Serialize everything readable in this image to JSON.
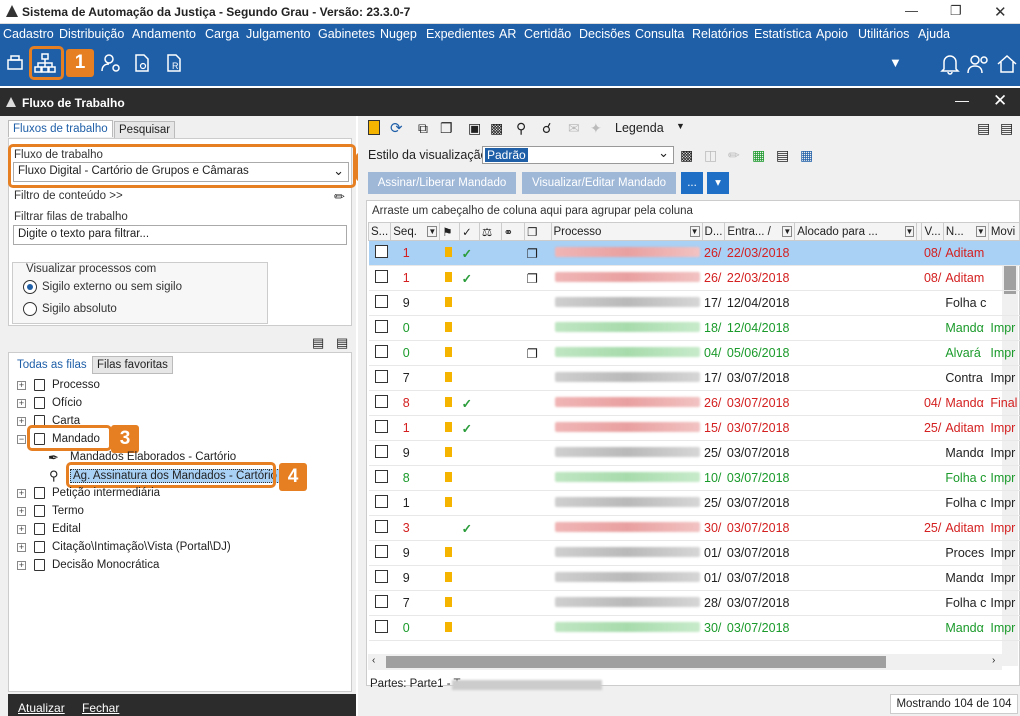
{
  "app": {
    "title": "Sistema de Automação da Justiça - Segundo Grau - Versão: 23.3.0-7"
  },
  "menu": [
    "Cadastro",
    "Distribuição",
    "Andamento",
    "Carga",
    "Julgamento",
    "Gabinetes",
    "Nugep",
    "Expedientes",
    "AR",
    "Certidão",
    "Decisões",
    "Consulta",
    "Relatórios",
    "Estatística",
    "Apoio",
    "Utilitários",
    "Ajuda"
  ],
  "callouts": [
    "1",
    "2",
    "3",
    "4"
  ],
  "workflow_window": {
    "title": "Fluxo de Trabalho"
  },
  "left": {
    "tabs": [
      "Fluxos de trabalho",
      "Pesquisar"
    ],
    "flow_label": "Fluxo de trabalho",
    "flow_value": "Fluxo Digital - Cartório de Grupos e Câmaras",
    "content_filter": "Filtro de conteúdo >>",
    "filter_queues_label": "Filtrar filas de trabalho",
    "filter_placeholder": "Digite o texto para filtrar...",
    "visualize_label": "Visualizar processos com",
    "radio1": "Sigilo externo ou sem sigilo",
    "radio2": "Sigilo absoluto",
    "queue_tabs": [
      "Todas as filas",
      "Filas favoritas"
    ],
    "tree": [
      "Processo",
      "Ofício",
      "Carta",
      "Mandado",
      "Mandados Elaborados - Cartório",
      "Ag. Assinatura dos Mandados - Cartório",
      "Petição intermediária",
      "Termo",
      "Edital",
      "Citação\\Intimação\\Vista (Portal\\DJ)",
      "Decisão Monocrática"
    ],
    "footer": [
      "Atualizar",
      "Fechar"
    ]
  },
  "right": {
    "legend": "Legenda",
    "view_label": "Estilo da visualização",
    "view_value": "Padrão",
    "btn_sign": "Assinar/Liberar Mandado",
    "btn_view": "Visualizar/Editar Mandado",
    "btn_more": "...",
    "group_hint": "Arraste um cabeçalho de coluna aqui para agrupar pela coluna",
    "columns": [
      "S...",
      "Seq.",
      "",
      "",
      "",
      "",
      "",
      "Processo",
      "D...",
      "Entra... /",
      "Alocado para ...",
      "",
      "V...",
      "N...",
      "Movi"
    ],
    "rows": [
      {
        "seq": "1",
        "flag": true,
        "chk": true,
        "link": true,
        "c": "red",
        "d": "26/",
        "date": "22/03/2018",
        "v": "08/",
        "n": "Aditam",
        "sel": true
      },
      {
        "seq": "1",
        "flag": true,
        "chk": true,
        "link": true,
        "c": "red",
        "d": "26/",
        "date": "22/03/2018",
        "v": "08/",
        "n": "Aditam"
      },
      {
        "seq": "9",
        "flag": true,
        "chk": false,
        "link": false,
        "c": "",
        "d": "17/",
        "date": "12/04/2018",
        "v": "",
        "n": "Folha c"
      },
      {
        "seq": "0",
        "flag": true,
        "chk": false,
        "link": false,
        "c": "green",
        "d": "18/",
        "date": "12/04/2018",
        "v": "",
        "n": "Mandα",
        "m": "Impr"
      },
      {
        "seq": "0",
        "flag": true,
        "chk": false,
        "link": true,
        "c": "green",
        "d": "04/",
        "date": "05/06/2018",
        "v": "",
        "n": "Alvará",
        "m": "Impr"
      },
      {
        "seq": "7",
        "flag": true,
        "chk": false,
        "link": false,
        "c": "",
        "d": "17/",
        "date": "03/07/2018",
        "v": "",
        "n": "Contra",
        "m": "Impr"
      },
      {
        "seq": "8",
        "flag": true,
        "chk": true,
        "link": false,
        "c": "red",
        "d": "26/",
        "date": "03/07/2018",
        "v": "04/",
        "n": "Mandα",
        "m": "Final"
      },
      {
        "seq": "1",
        "flag": true,
        "chk": true,
        "link": false,
        "c": "red",
        "d": "15/",
        "date": "03/07/2018",
        "v": "25/",
        "n": "Aditam",
        "m": "Impr"
      },
      {
        "seq": "9",
        "flag": true,
        "chk": false,
        "link": false,
        "c": "",
        "d": "25/",
        "date": "03/07/2018",
        "v": "",
        "n": "Mandα",
        "m": "Impr"
      },
      {
        "seq": "8",
        "flag": true,
        "chk": false,
        "link": false,
        "c": "green",
        "d": "10/",
        "date": "03/07/2018",
        "v": "",
        "n": "Folha c",
        "m": "Impr"
      },
      {
        "seq": "1",
        "flag": true,
        "chk": false,
        "link": false,
        "c": "",
        "d": "25/",
        "date": "03/07/2018",
        "v": "",
        "n": "Folha c",
        "m": "Impr"
      },
      {
        "seq": "3",
        "flag": false,
        "chk": true,
        "link": false,
        "c": "red",
        "d": "30/",
        "date": "03/07/2018",
        "v": "25/",
        "n": "Aditam",
        "m": "Impr"
      },
      {
        "seq": "9",
        "flag": true,
        "chk": false,
        "link": false,
        "c": "",
        "d": "01/",
        "date": "03/07/2018",
        "v": "",
        "n": "Proces",
        "m": "Impr"
      },
      {
        "seq": "9",
        "flag": true,
        "chk": false,
        "link": false,
        "c": "",
        "d": "01/",
        "date": "03/07/2018",
        "v": "",
        "n": "Mandα",
        "m": "Impr"
      },
      {
        "seq": "7",
        "flag": true,
        "chk": false,
        "link": false,
        "c": "",
        "d": "28/",
        "date": "03/07/2018",
        "v": "",
        "n": "Folha c",
        "m": "Impr"
      },
      {
        "seq": "0",
        "flag": true,
        "chk": false,
        "link": false,
        "c": "green",
        "d": "30/",
        "date": "03/07/2018",
        "v": "",
        "n": "Mandα",
        "m": "Impr"
      }
    ],
    "parts_label": "Partes: Parte1 - T",
    "status": "Mostrando 104 de 104"
  },
  "colors": {
    "accent": "#1f5fa8",
    "callout": "#e67e22",
    "red": "#d42020",
    "green": "#1a9a2a"
  }
}
